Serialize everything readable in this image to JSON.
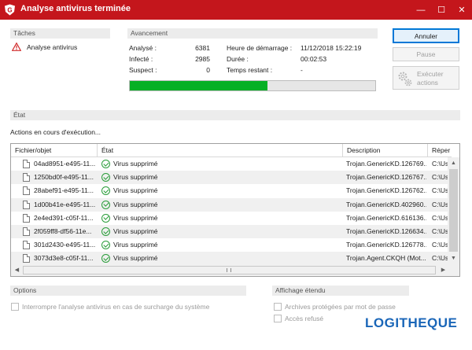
{
  "window": {
    "title": "Analyse antivirus terminée",
    "minimize": "—",
    "maximize": "☐",
    "close": "✕"
  },
  "colors": {
    "accent": "#c4161c",
    "progress": "#06b025",
    "brand": "#1a66b8"
  },
  "tasks": {
    "header": "Tâches",
    "item": "Analyse antivirus"
  },
  "progress": {
    "header": "Avancement",
    "analyzed_label": "Analysé :",
    "analyzed_value": "6381",
    "infected_label": "Infecté :",
    "infected_value": "2985",
    "suspect_label": "Suspect :",
    "suspect_value": "0",
    "start_label": "Heure de démarrage :",
    "start_value": "11/12/2018 15:22:19",
    "duration_label": "Durée :",
    "duration_value": "00:02:53",
    "remaining_label": "Temps restant :",
    "remaining_value": "-",
    "fraction": 0.56
  },
  "buttons": {
    "cancel": "Annuler",
    "pause": "Pause",
    "execute_line1": "Exécuter",
    "execute_line2": "actions"
  },
  "state": {
    "header": "État",
    "message": "Actions en cours d'exécution..."
  },
  "table": {
    "columns": [
      "Fichier/objet",
      "État",
      "Description",
      "Réper"
    ],
    "rows": [
      {
        "file": "04ad8951-e495-11...",
        "status": "Virus supprimé",
        "desc": "Trojan.GenericKD.126769...",
        "path": "C:\\Us"
      },
      {
        "file": "1250bd0f-e495-11...",
        "status": "Virus supprimé",
        "desc": "Trojan.GenericKD.126767...",
        "path": "C:\\Us"
      },
      {
        "file": "28abef91-e495-11...",
        "status": "Virus supprimé",
        "desc": "Trojan.GenericKD.126762...",
        "path": "C:\\Us"
      },
      {
        "file": "1d00b41e-e495-11...",
        "status": "Virus supprimé",
        "desc": "Trojan.GenericKD.402960...",
        "path": "C:\\Us"
      },
      {
        "file": "2e4ed391-c05f-11...",
        "status": "Virus supprimé",
        "desc": "Trojan.GenericKD.616136...",
        "path": "C:\\Us"
      },
      {
        "file": "2f059ff8-df56-11e...",
        "status": "Virus supprimé",
        "desc": "Trojan.GenericKD.126634...",
        "path": "C:\\Us"
      },
      {
        "file": "301d2430-e495-11...",
        "status": "Virus supprimé",
        "desc": "Trojan.GenericKD.126778...",
        "path": "C:\\Us"
      },
      {
        "file": "3073d3e8-c05f-11...",
        "status": "Virus supprimé",
        "desc": "Trojan.Agent.CKQH (Mot...",
        "path": "C:\\Us"
      }
    ]
  },
  "options": {
    "header": "Options",
    "interrupt": "Interrompre l'analyse antivirus en cas de surcharge du système"
  },
  "extended": {
    "header": "Affichage étendu",
    "archives": "Archives protégées par mot de passe",
    "denied": "Accès refusé"
  },
  "watermark": "LOGITHEQUE"
}
